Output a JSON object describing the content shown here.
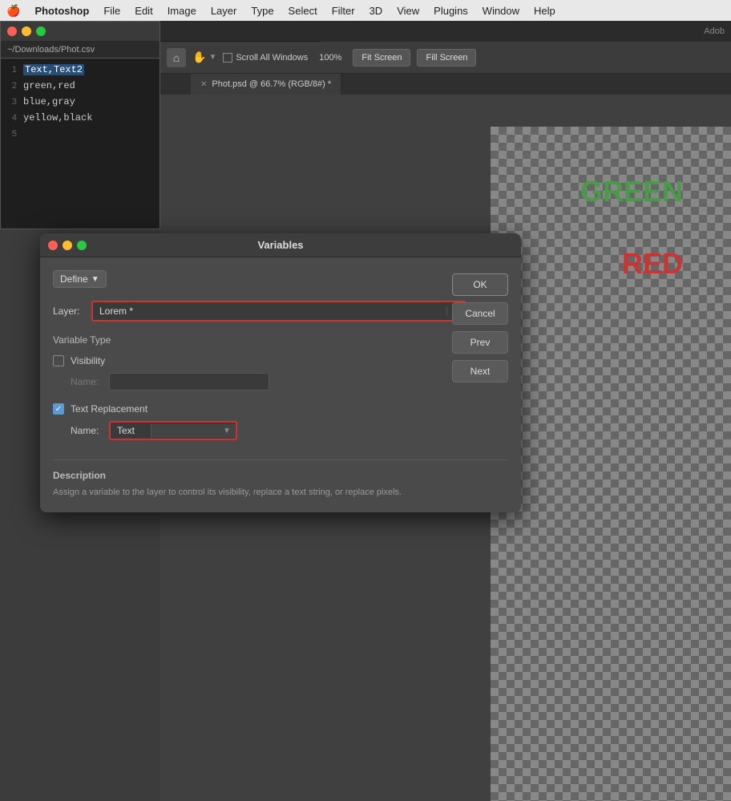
{
  "menubar": {
    "apple": "🍎",
    "items": [
      "Photoshop",
      "File",
      "Edit",
      "Image",
      "Layer",
      "Type",
      "Select",
      "Filter",
      "3D",
      "View",
      "Plugins",
      "Window",
      "Help"
    ]
  },
  "topright": {
    "adobe_label": "Adob"
  },
  "secondary_toolbar": {
    "zoom": "100%",
    "fit_screen": "Fit Screen",
    "fill_screen": "Fill Screen",
    "scroll_all_windows": "Scroll All Windows"
  },
  "tab": {
    "label": "Phot.psd @ 66.7% (RGB/8#) *"
  },
  "text_editor": {
    "path": "~/Downloads/Phot.csv",
    "lines": [
      {
        "num": "1",
        "text": "Text,Text2",
        "selected": true
      },
      {
        "num": "2",
        "text": "green,red"
      },
      {
        "num": "3",
        "text": "blue,gray"
      },
      {
        "num": "4",
        "text": "yellow,black"
      },
      {
        "num": "5",
        "text": ""
      }
    ]
  },
  "canvas": {
    "green_text": "GREEN",
    "red_text": "RED"
  },
  "dialog": {
    "title": "Variables",
    "define_label": "Define",
    "layer_label": "Layer:",
    "layer_value": "Lorem *",
    "variable_type_label": "Variable Type",
    "visibility_label": "Visibility",
    "visibility_checked": false,
    "name_label": "Name:",
    "name_value": "",
    "text_replacement_label": "Text Replacement",
    "text_replacement_checked": true,
    "name_value_label": "Name:",
    "name_value_text": "Text",
    "name_dropdown_text": "",
    "ok_label": "OK",
    "cancel_label": "Cancel",
    "prev_label": "Prev",
    "next_label": "Next",
    "description_title": "Description",
    "description_text": "Assign a variable to the layer to control its visibility, replace a text string, or replace pixels."
  }
}
